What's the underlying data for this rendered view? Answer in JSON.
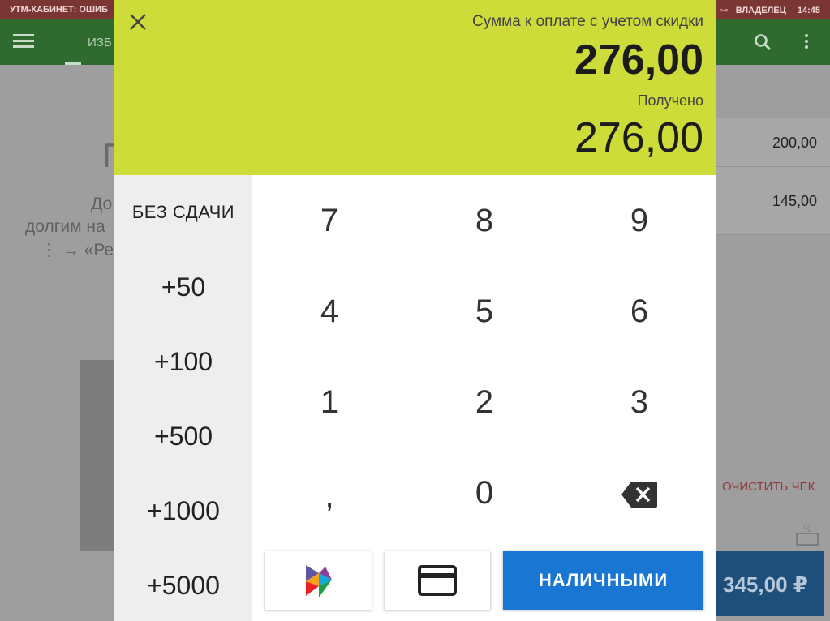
{
  "status_bar": {
    "left_text": "УТМ-КАБИНЕТ: ОШИБ",
    "user": "ВЛАДЕЛЕЦ",
    "time": "14:45"
  },
  "toolbar": {
    "tab_label": "ИЗБ"
  },
  "background": {
    "title": "П",
    "hint_lines": [
      "До",
      "долгим на",
      "⋮ → «Реда"
    ],
    "rows": [
      {
        "amount": "200,00"
      },
      {
        "amount": "145,00"
      }
    ],
    "clear_label": "ОЧИСТИТЬ ЧЕК",
    "total": "345,00 ₽"
  },
  "dialog": {
    "sum_label": "Сумма к оплате с учетом скидки",
    "sum_value": "276,00",
    "received_label": "Получено",
    "received_value": "276,00",
    "quick_buttons": [
      "БЕЗ СДАЧИ",
      "+50",
      "+100",
      "+500",
      "+1000",
      "+5000"
    ],
    "keys": [
      "7",
      "8",
      "9",
      "4",
      "5",
      "6",
      "1",
      "2",
      "3",
      ",",
      "0"
    ],
    "backspace_icon": "backspace-icon",
    "pay_buttons": {
      "sbp_icon": "sbp-logo-icon",
      "card_icon": "credit-card-icon",
      "cash_label": "НАЛИЧНЫМИ"
    },
    "colors": {
      "header_bg": "#cddc39",
      "cash_button": "#1976d2",
      "quick_bg": "#eeeeee"
    }
  }
}
